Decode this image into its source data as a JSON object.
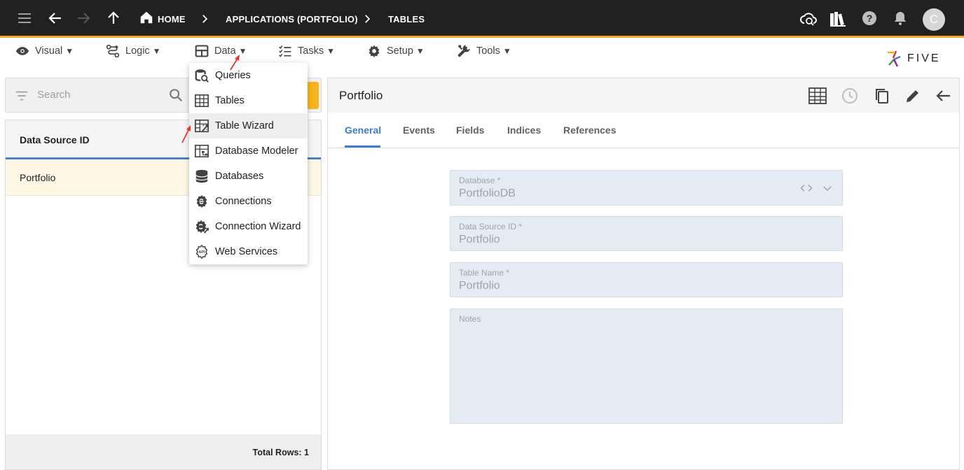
{
  "topbar": {
    "breadcrumbs": [
      "HOME",
      "APPLICATIONS (PORTFOLIO)",
      "TABLES"
    ],
    "user_initial": "C",
    "accent_color": "#f6a91c"
  },
  "menubar": {
    "items": [
      {
        "label": "Visual",
        "icon": "eye-icon"
      },
      {
        "label": "Logic",
        "icon": "logic-icon"
      },
      {
        "label": "Data",
        "icon": "table-icon"
      },
      {
        "label": "Tasks",
        "icon": "checklist-icon"
      },
      {
        "label": "Setup",
        "icon": "gear-icon"
      },
      {
        "label": "Tools",
        "icon": "tools-icon"
      }
    ],
    "caret": "▼",
    "logo_text": "FIVE"
  },
  "data_menu": {
    "items": [
      {
        "label": "Queries",
        "icon": "queries-icon"
      },
      {
        "label": "Tables",
        "icon": "table-icon"
      },
      {
        "label": "Table Wizard",
        "icon": "table-wizard-icon"
      },
      {
        "label": "Database Modeler",
        "icon": "database-modeler-icon"
      },
      {
        "label": "Databases",
        "icon": "database-icon"
      },
      {
        "label": "Connections",
        "icon": "connections-icon"
      },
      {
        "label": "Connection Wizard",
        "icon": "connection-wizard-icon"
      },
      {
        "label": "Web Services",
        "icon": "web-services-icon"
      }
    ],
    "hovered": "Table Wizard"
  },
  "left_panel": {
    "search_placeholder": "Search",
    "column_header": "Data Source ID",
    "rows": [
      "Portfolio"
    ],
    "total_rows": "Total Rows: 1"
  },
  "right_panel": {
    "title": "Portfolio",
    "tabs": [
      "General",
      "Events",
      "Fields",
      "Indices",
      "References"
    ],
    "active_tab": "General",
    "fields": {
      "database": {
        "label": "Database *",
        "value": "PortfolioDB"
      },
      "data_source_id": {
        "label": "Data Source ID *",
        "value": "Portfolio"
      },
      "table_name": {
        "label": "Table Name *",
        "value": "Portfolio"
      },
      "notes": {
        "label": "Notes",
        "value": ""
      }
    }
  }
}
